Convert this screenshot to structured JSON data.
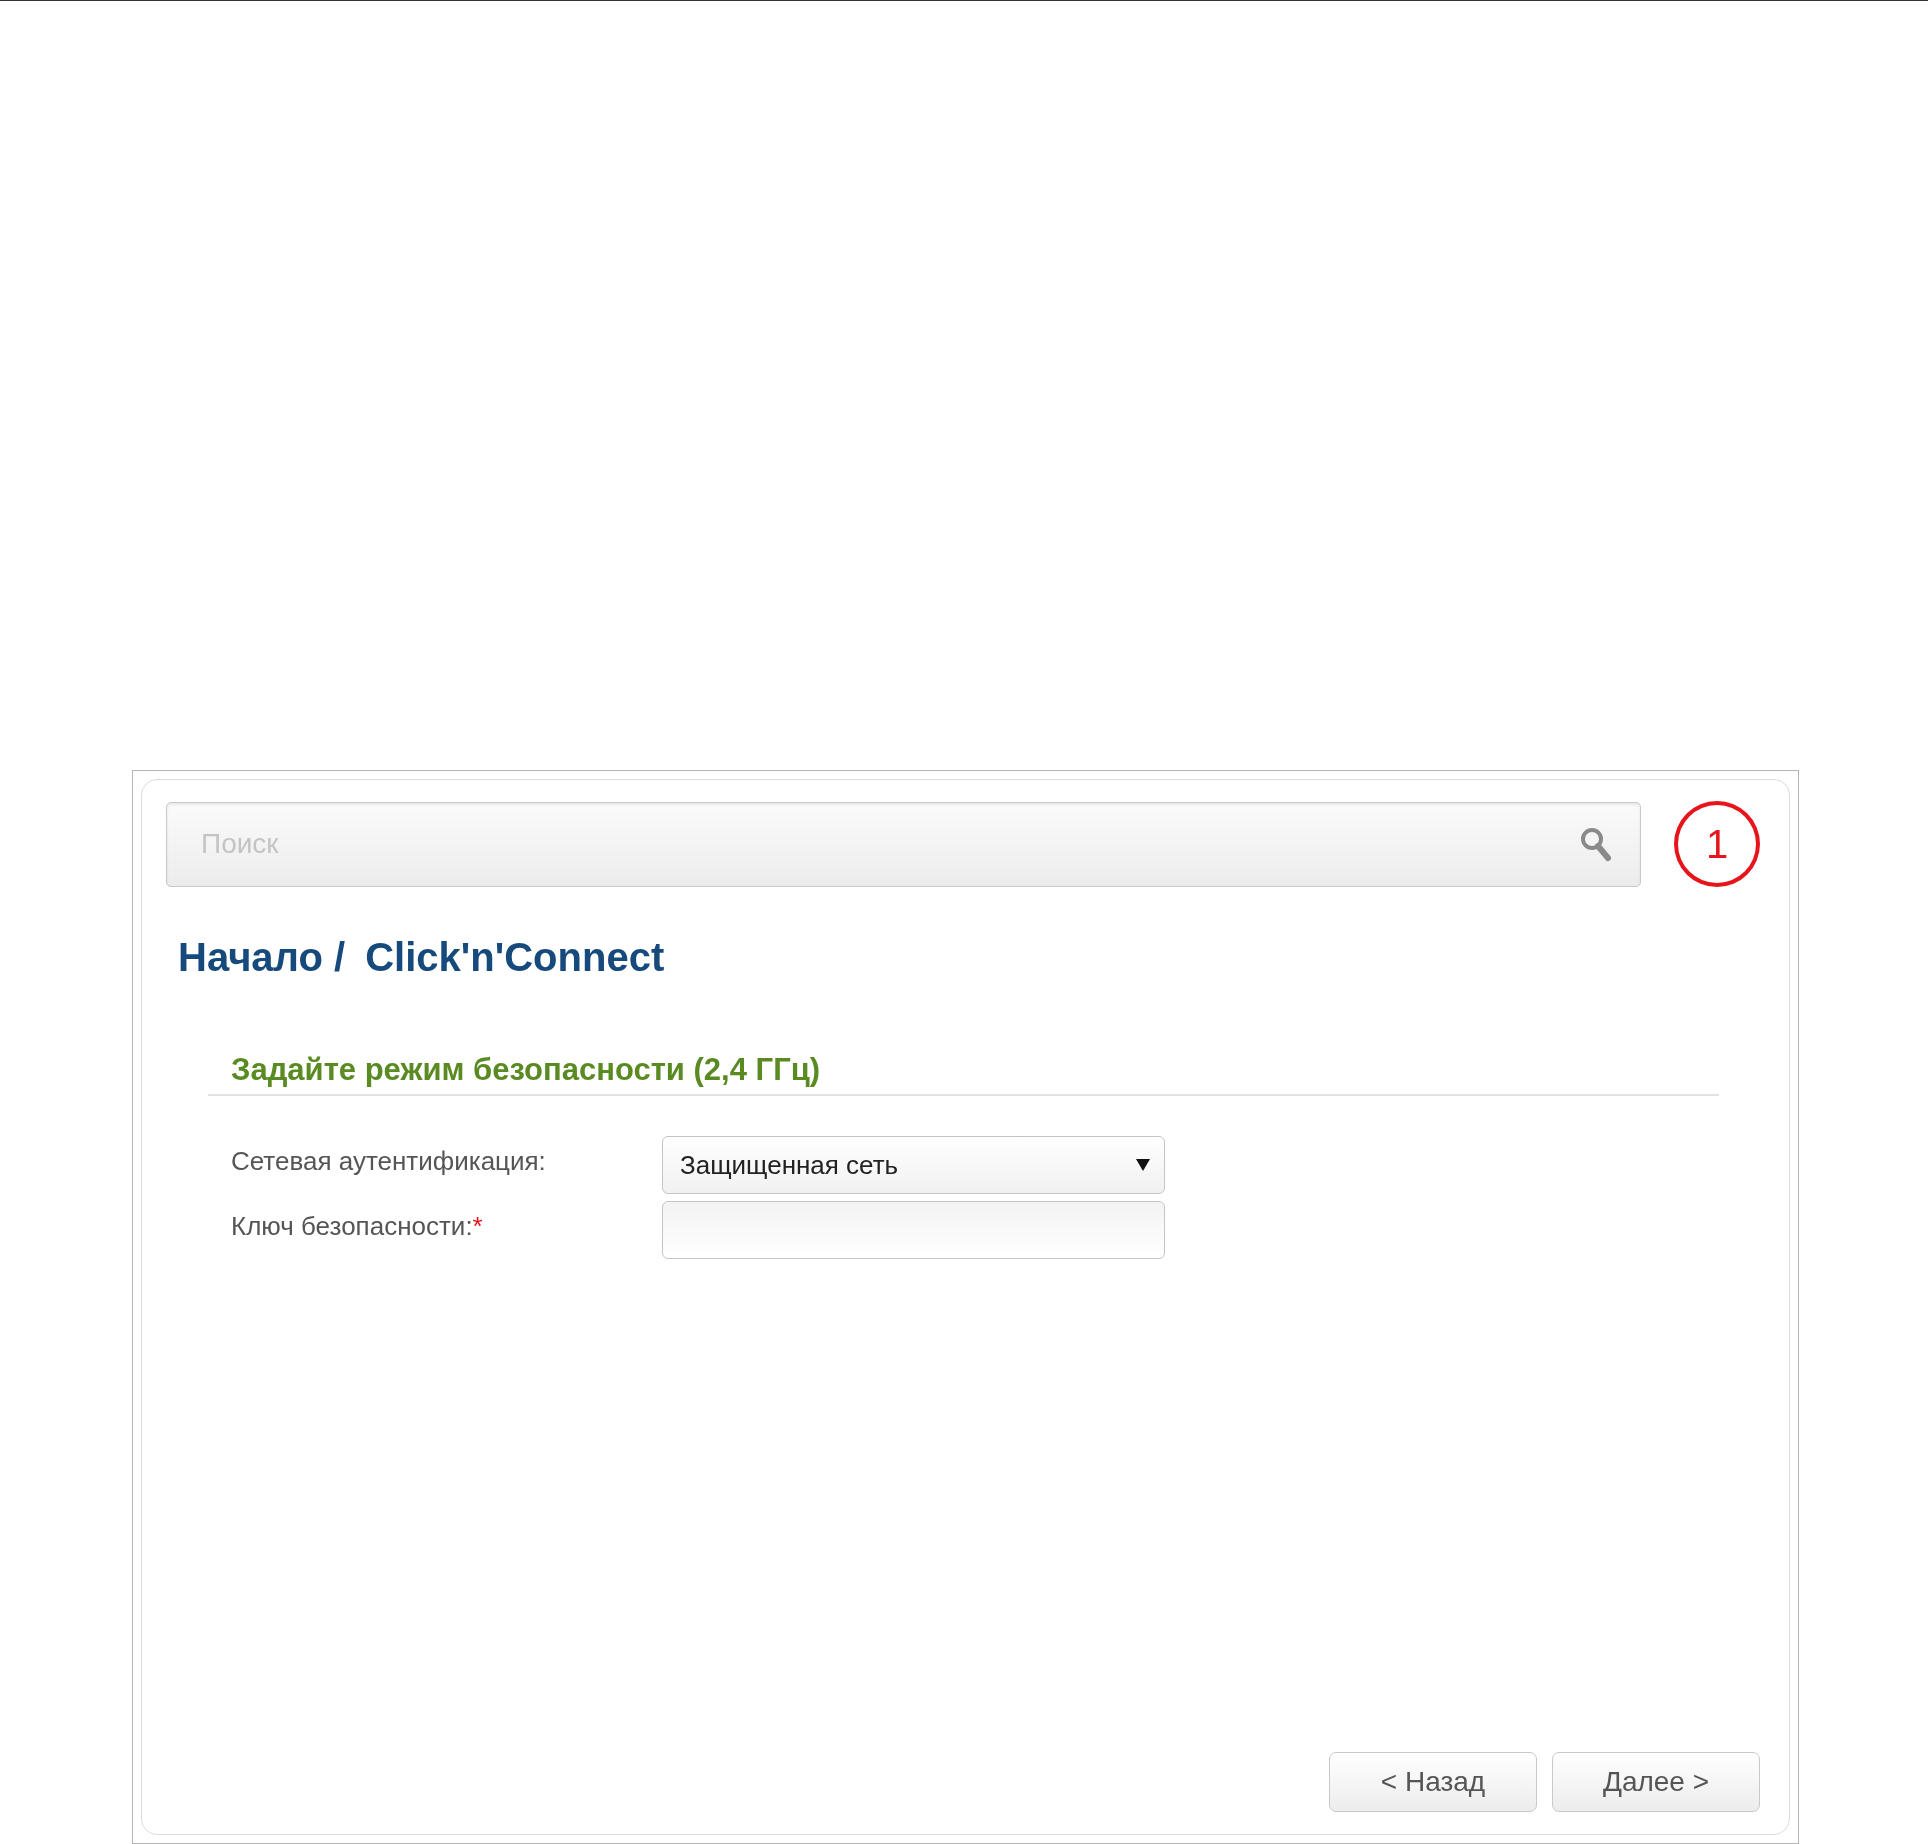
{
  "search": {
    "placeholder": "Поиск"
  },
  "callout": {
    "label": "1"
  },
  "breadcrumb": [
    "Начало /",
    "Click'n'Connect"
  ],
  "section": {
    "title": "Задайте режим безопасности (2,4 ГГц)",
    "fields": [
      {
        "kind": "select",
        "label": "Сетевая аутентификация:",
        "value": "Защищенная сеть"
      },
      {
        "kind": "text",
        "label": "Ключ безопасности:",
        "required_mark": "*"
      }
    ]
  },
  "buttons": [
    "< Назад",
    "Далее >"
  ]
}
